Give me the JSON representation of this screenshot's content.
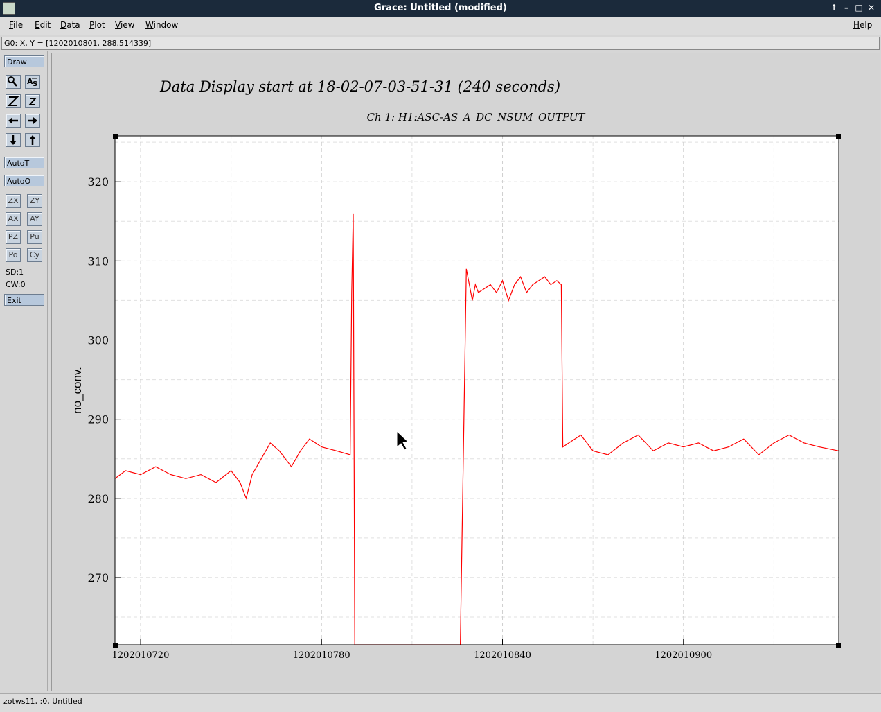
{
  "window": {
    "title": "Grace: Untitled (modified)",
    "controls": [
      "↑",
      "–",
      "□",
      "✕"
    ]
  },
  "menubar": {
    "items": [
      {
        "first": "F",
        "rest": "ile"
      },
      {
        "first": "E",
        "rest": "dit"
      },
      {
        "first": "D",
        "rest": "ata"
      },
      {
        "first": "P",
        "rest": "lot"
      },
      {
        "first": "V",
        "rest": "iew"
      },
      {
        "first": "W",
        "rest": "indow"
      }
    ],
    "help": {
      "first": "H",
      "rest": "elp"
    }
  },
  "locator": {
    "text": "G0: X, Y = [1202010801, 288.514339]"
  },
  "toolbar": {
    "draw": "Draw",
    "autot": "AutoT",
    "autoo": "AutoO",
    "zx": "ZX",
    "zy": "ZY",
    "ax": "AX",
    "ay": "AY",
    "pz": "PZ",
    "pu": "Pu",
    "po": "Po",
    "cy": "Cy",
    "sd": "SD:1",
    "cw": "CW:0",
    "exit": "Exit",
    "icons": [
      "zoom-icon",
      "autoscale-icon",
      "zoom-x-icon",
      "zoom-y-icon",
      "left-arrow-icon",
      "right-arrow-icon",
      "down-arrow-icon",
      "up-arrow-icon"
    ]
  },
  "status": {
    "text": "zotws11, :0, Untitled"
  },
  "chart_data": {
    "type": "line",
    "title": "Data Display start at 18-02-07-03-51-31 (240 seconds)",
    "subtitle": "Ch 1: H1:ASC-AS_A_DC_NSUM_OUTPUT",
    "xlabel": "",
    "ylabel": "no_conv.",
    "xlim": [
      1202010711.5,
      1202010951.5
    ],
    "ylim": [
      261.5,
      325.8
    ],
    "x_ticks": [
      1202010720,
      1202010780,
      1202010840,
      1202010900
    ],
    "y_ticks": [
      270,
      280,
      290,
      300,
      310,
      320
    ],
    "grid": true,
    "series_color": "#ff0000",
    "series": [
      {
        "x": [
          1202010711.5,
          1202010715,
          1202010720,
          1202010725,
          1202010730,
          1202010735,
          1202010740,
          1202010745,
          1202010750,
          1202010753,
          1202010755,
          1202010757,
          1202010760,
          1202010763,
          1202010766,
          1202010770,
          1202010773,
          1202010776,
          1202010780,
          1202010785,
          1202010789.5,
          1202010790,
          1202010790.5,
          1202010791,
          1202010826,
          1202010828,
          1202010830,
          1202010831,
          1202010832,
          1202010834,
          1202010836,
          1202010838,
          1202010840,
          1202010842,
          1202010844,
          1202010846,
          1202010848,
          1202010850,
          1202010852,
          1202010854,
          1202010856,
          1202010858,
          1202010859.5,
          1202010860,
          1202010862,
          1202010866,
          1202010870,
          1202010875,
          1202010880,
          1202010885,
          1202010890,
          1202010895,
          1202010900,
          1202010905,
          1202010910,
          1202010915,
          1202010920,
          1202010925,
          1202010930,
          1202010935,
          1202010940,
          1202010945,
          1202010951.5
        ],
        "y": [
          282.5,
          283.5,
          283,
          284,
          283,
          282.5,
          283,
          282,
          283.5,
          282,
          280,
          283,
          285,
          287,
          286,
          284,
          286,
          287.5,
          286.5,
          286,
          285.5,
          306,
          316,
          261.5,
          261.5,
          309,
          305,
          307,
          306,
          306.5,
          307,
          306,
          307.5,
          305,
          307,
          308,
          306,
          307,
          307.5,
          308,
          307,
          307.5,
          307,
          286.5,
          287,
          288,
          286,
          285.5,
          287,
          288,
          286,
          287,
          286.5,
          287,
          286,
          286.5,
          287.5,
          285.5,
          287,
          288,
          287,
          286.5,
          286
        ]
      }
    ]
  }
}
